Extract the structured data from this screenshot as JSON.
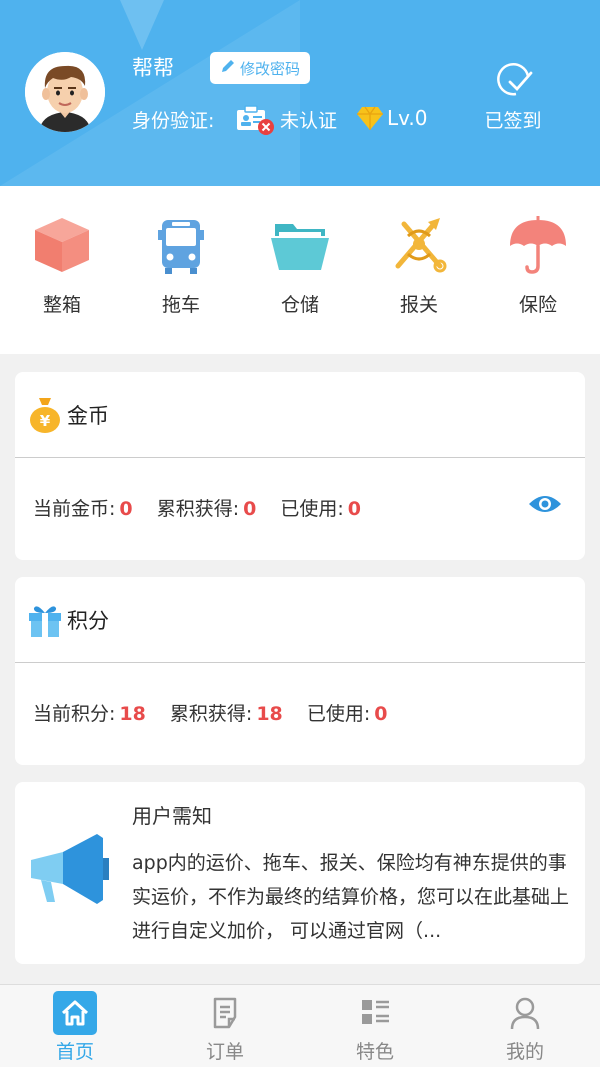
{
  "header": {
    "username": "帮帮",
    "change_password_label": "修改密码",
    "identity_label": "身份验证:",
    "identity_status": "未认证",
    "level": "Lv.0",
    "signin_label": "已签到"
  },
  "services": [
    {
      "label": "整箱",
      "icon": "box-icon"
    },
    {
      "label": "拖车",
      "icon": "bus-icon"
    },
    {
      "label": "仓储",
      "icon": "folder-icon"
    },
    {
      "label": "报关",
      "icon": "customs-icon"
    },
    {
      "label": "保险",
      "icon": "umbrella-icon"
    }
  ],
  "coins": {
    "title": "金币",
    "current_label": "当前金币:",
    "current_value": "0",
    "earned_label": "累积获得:",
    "earned_value": "0",
    "used_label": "已使用:",
    "used_value": "0"
  },
  "points": {
    "title": "积分",
    "current_label": "当前积分:",
    "current_value": "18",
    "earned_label": "累积获得:",
    "earned_value": "18",
    "used_label": "已使用:",
    "used_value": "0"
  },
  "notice": {
    "title": "用户需知",
    "body": "app内的运价、拖车、报关、保险均有神东提供的事实运价，不作为最终的结算价格，您可以在此基础上进行自定义加价， 可以通过官网（..."
  },
  "tabs": [
    {
      "label": "首页",
      "active": true
    },
    {
      "label": "订单",
      "active": false
    },
    {
      "label": "特色",
      "active": false
    },
    {
      "label": "我的",
      "active": false
    }
  ],
  "colors": {
    "header_bg": "#4fb2ee",
    "accent": "#35a8e8",
    "value_red": "#e84b4b"
  }
}
